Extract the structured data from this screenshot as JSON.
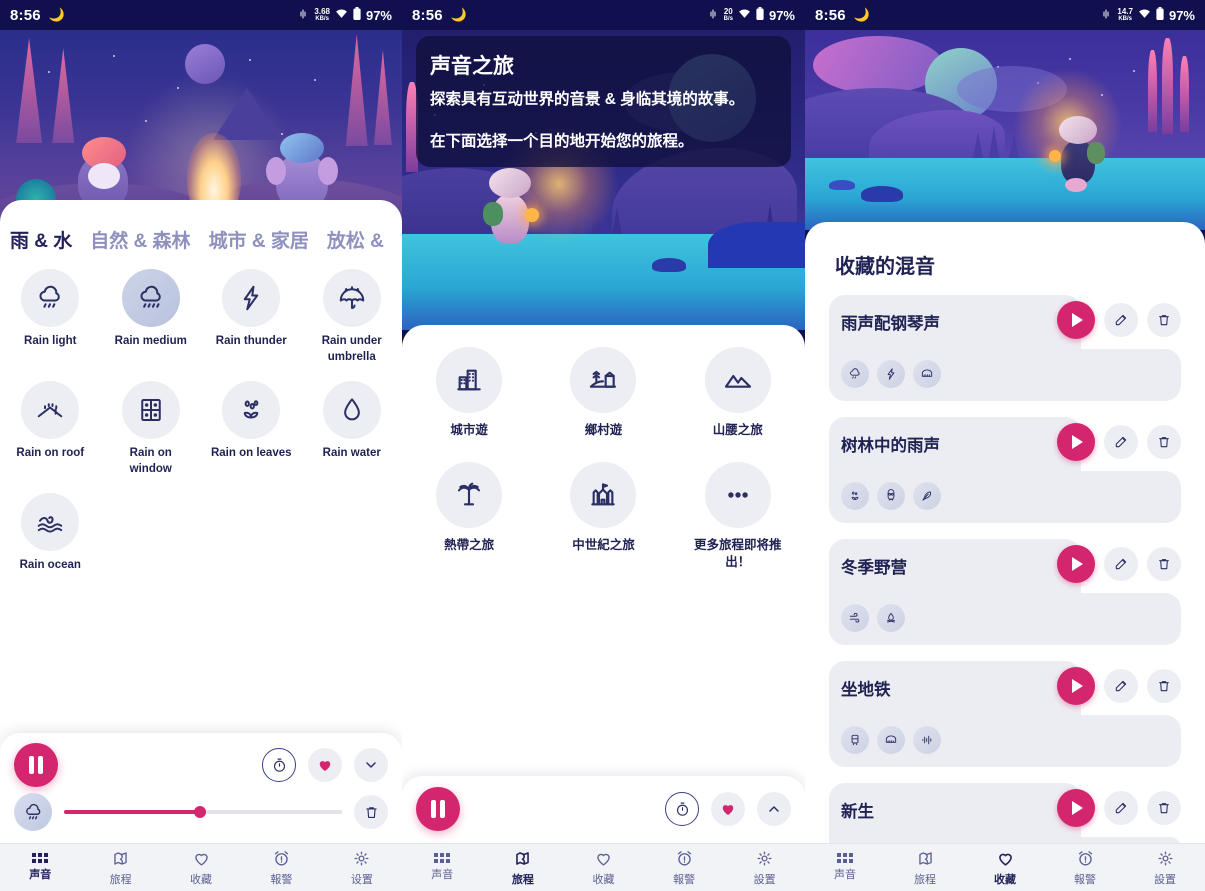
{
  "accent": "#d4266e",
  "ink": "#22215c",
  "screens": [
    {
      "id": "sounds",
      "status": {
        "time": "8:56",
        "moon_icon": "moon-icon",
        "vibrate_icon": "vibrate-icon",
        "net_rate": "3.68",
        "net_unit": "KB/s",
        "wifi_icon": "wifi-icon",
        "battery": "97%"
      },
      "categories": [
        {
          "label": "雨 & 水",
          "active": true
        },
        {
          "label": "自然 & 森林",
          "active": false
        },
        {
          "label": "城市 & 家居",
          "active": false
        },
        {
          "label": "放松 &",
          "active": false
        }
      ],
      "sounds": [
        {
          "label": "Rain light",
          "icon": "rain-cloud-icon",
          "active": false
        },
        {
          "label": "Rain medium",
          "icon": "rain-cloud-icon",
          "active": true
        },
        {
          "label": "Rain thunder",
          "icon": "lightning-bolt-icon",
          "active": false
        },
        {
          "label": "Rain under umbrella",
          "icon": "umbrella-icon",
          "active": false
        },
        {
          "label": "Rain on roof",
          "icon": "roof-icon",
          "active": false
        },
        {
          "label": "Rain on window",
          "icon": "window-icon",
          "active": false
        },
        {
          "label": "Rain on leaves",
          "icon": "leaves-icon",
          "active": false
        },
        {
          "label": "Rain water",
          "icon": "waterdrop-icon",
          "active": false
        },
        {
          "label": "Rain ocean",
          "icon": "ocean-wave-icon",
          "active": false
        }
      ],
      "player": {
        "pause_icon": "pause-icon",
        "timer_icon": "timer-icon",
        "heart_icon": "heart-filled-icon",
        "chevron_icon": "chevron-down-icon",
        "track_icon": "rain-cloud-icon",
        "trash_icon": "trash-icon",
        "volume_percent": 49,
        "expanded": true
      },
      "nav": [
        {
          "label": "声音",
          "icon": "grid-dots-icon",
          "active": true
        },
        {
          "label": "旅程",
          "icon": "journey-icon",
          "active": false
        },
        {
          "label": "收藏",
          "icon": "heart-outline-icon",
          "active": false
        },
        {
          "label": "報警",
          "icon": "alarm-icon",
          "active": false
        },
        {
          "label": "设置",
          "icon": "gear-icon",
          "active": false
        }
      ]
    },
    {
      "id": "journeys",
      "status": {
        "time": "8:56",
        "moon_icon": "moon-icon",
        "vibrate_icon": "vibrate-icon",
        "net_rate": "20",
        "net_unit": "B/s",
        "wifi_icon": "wifi-icon",
        "battery": "97%"
      },
      "header": {
        "title": "声音之旅",
        "line1": "探索具有互动世界的音景 & 身临其境的故事。",
        "line2": "在下面选择一个目的地开始您的旅程。"
      },
      "journeys": [
        {
          "label": "城市遊",
          "icon": "city-buildings-icon"
        },
        {
          "label": "鄉村遊",
          "icon": "countryside-icon"
        },
        {
          "label": "山腰之旅",
          "icon": "mountain-icon"
        },
        {
          "label": "熱帶之旅",
          "icon": "palm-tree-icon"
        },
        {
          "label": "中世紀之旅",
          "icon": "castle-icon"
        },
        {
          "label": "更多旅程即将推出！",
          "icon": "ellipsis-icon"
        }
      ],
      "player": {
        "pause_icon": "pause-icon",
        "timer_icon": "timer-icon",
        "heart_icon": "heart-filled-icon",
        "chevron_icon": "chevron-up-icon",
        "expanded": false
      },
      "nav": [
        {
          "label": "声音",
          "icon": "grid-dots-icon",
          "active": false
        },
        {
          "label": "旅程",
          "icon": "journey-icon",
          "active": true
        },
        {
          "label": "收藏",
          "icon": "heart-outline-icon",
          "active": false
        },
        {
          "label": "報警",
          "icon": "alarm-icon",
          "active": false
        },
        {
          "label": "設置",
          "icon": "gear-icon",
          "active": false
        }
      ]
    },
    {
      "id": "favorites",
      "status": {
        "time": "8:56",
        "moon_icon": "moon-icon",
        "vibrate_icon": "vibrate-icon",
        "net_rate": "14.7",
        "net_unit": "KB/s",
        "wifi_icon": "wifi-icon",
        "battery": "97%"
      },
      "title": "收藏的混音",
      "favorites": [
        {
          "name": "雨声配钢琴声",
          "chips": [
            "rain-cloud-icon",
            "lightning-bolt-icon",
            "piano-icon"
          ],
          "play_icon": "play-icon",
          "edit_icon": "edit-icon",
          "delete_icon": "trash-icon"
        },
        {
          "name": "树林中的雨声",
          "chips": [
            "leaves-icon",
            "owl-icon",
            "feather-icon"
          ],
          "play_icon": "play-icon",
          "edit_icon": "edit-icon",
          "delete_icon": "trash-icon"
        },
        {
          "name": "冬季野营",
          "chips": [
            "wind-icon",
            "campfire-icon"
          ],
          "play_icon": "play-icon",
          "edit_icon": "edit-icon",
          "delete_icon": "trash-icon"
        },
        {
          "name": "坐地铁",
          "chips": [
            "train-icon",
            "piano-icon",
            "waveform-icon"
          ],
          "play_icon": "play-icon",
          "edit_icon": "edit-icon",
          "delete_icon": "trash-icon"
        },
        {
          "name": "新生",
          "chips": [],
          "play_icon": "play-icon",
          "edit_icon": "edit-icon",
          "delete_icon": "trash-icon"
        }
      ],
      "nav": [
        {
          "label": "声音",
          "icon": "grid-dots-icon",
          "active": false
        },
        {
          "label": "旅程",
          "icon": "journey-icon",
          "active": false
        },
        {
          "label": "收藏",
          "icon": "heart-outline-icon",
          "active": true
        },
        {
          "label": "報警",
          "icon": "alarm-icon",
          "active": false
        },
        {
          "label": "設置",
          "icon": "gear-icon",
          "active": false
        }
      ]
    }
  ]
}
